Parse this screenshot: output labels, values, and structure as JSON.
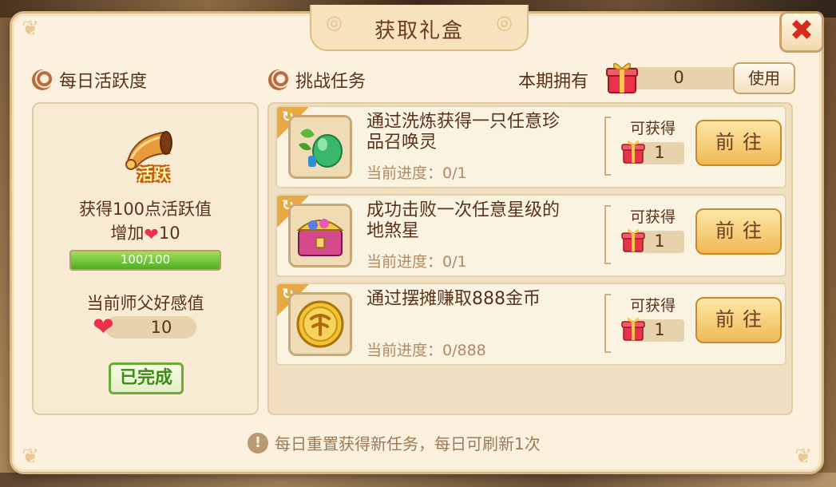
{
  "dialog": {
    "title": "获取礼盒",
    "close_icon": "close-icon"
  },
  "daily": {
    "section_title": "每日活跃度",
    "badge_text": "活跃",
    "gain_text": "获得100点活跃值",
    "add_prefix": "增加",
    "add_value": "10",
    "progress_text": "100/100",
    "progress_fraction": 1.0,
    "favor_label": "当前师父好感值",
    "favor_value": "10",
    "done_label": "已完成"
  },
  "challenge": {
    "section_title": "挑战任务",
    "owned_label": "本期拥有",
    "owned_value": "0",
    "use_label": "使用"
  },
  "tasks": [
    {
      "desc": "通过洗炼获得一只任意珍品召唤灵",
      "progress": "当前进度：0/1",
      "reward_label": "可获得",
      "reward_value": "1",
      "go_label": "前往",
      "item_icon": "gourd-icon"
    },
    {
      "desc": "成功击败一次任意星级的地煞星",
      "progress": "当前进度：0/1",
      "reward_label": "可获得",
      "reward_value": "1",
      "go_label": "前往",
      "item_icon": "treasure-chest-icon"
    },
    {
      "desc": "通过摆摊赚取888金币",
      "progress": "当前进度：0/888",
      "reward_label": "可获得",
      "reward_value": "1",
      "go_label": "前往",
      "item_icon": "gold-coin-icon"
    }
  ],
  "footer": {
    "note": "每日重置获得新任务，每日可刷新1次"
  },
  "colors": {
    "accent": "#f0b955",
    "progress_green": "#4fae25",
    "close_red": "#d62a1b",
    "heart": "#e8334a"
  }
}
